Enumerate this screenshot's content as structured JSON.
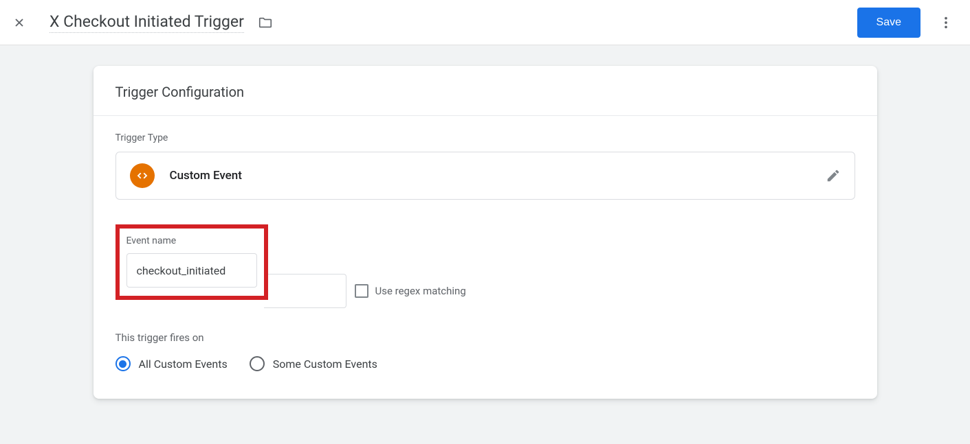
{
  "header": {
    "title": "X Checkout Initiated Trigger",
    "save_label": "Save"
  },
  "card": {
    "title": "Trigger Configuration",
    "trigger_type_label": "Trigger Type",
    "trigger_type_value": "Custom Event",
    "event_name_label": "Event name",
    "event_name_value": "checkout_initiated",
    "regex_label": "Use regex matching",
    "fires_on_label": "This trigger fires on",
    "radio_all_label": "All Custom Events",
    "radio_some_label": "Some Custom Events"
  }
}
